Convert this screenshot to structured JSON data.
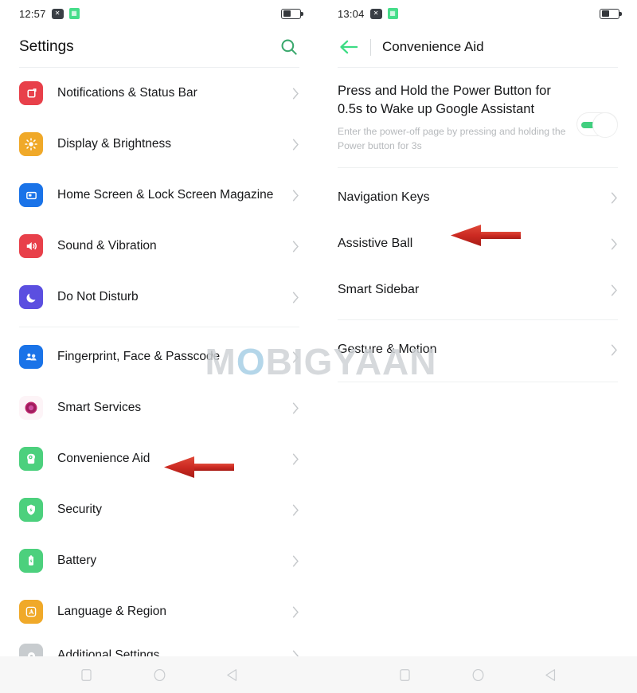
{
  "colors": {
    "accent_green": "#3ddc84",
    "toggle_on": "#41cf7f",
    "arrow_red": "#cc2a22",
    "text_primary": "#17181a",
    "text_muted": "#b6b9bc",
    "watermark": "#cfd3d6"
  },
  "left_screen": {
    "statusbar": {
      "time": "12:57",
      "icons": [
        "close-box-icon",
        "calculator-icon"
      ],
      "battery": {
        "name": "battery-icon",
        "level_pct": 45
      }
    },
    "header": {
      "title": "Settings",
      "search_icon": "search-icon"
    },
    "items": [
      {
        "label": "Notifications & Status Bar",
        "icon": "notifications-icon",
        "icon_bg": "#e8404a",
        "chevron": "chevron-right-icon"
      },
      {
        "label": "Display & Brightness",
        "icon": "brightness-icon",
        "icon_bg": "#f0a929",
        "chevron": "chevron-right-icon"
      },
      {
        "label": "Home Screen & Lock Screen Magazine",
        "icon": "home-screen-icon",
        "icon_bg": "#1a73e8",
        "chevron": "chevron-right-icon"
      },
      {
        "label": "Sound & Vibration",
        "icon": "sound-icon",
        "icon_bg": "#e8404a",
        "chevron": "chevron-right-icon"
      },
      {
        "label": "Do Not Disturb",
        "icon": "moon-icon",
        "icon_bg": "#5b4fe0",
        "chevron": "chevron-right-icon"
      },
      {
        "label": "Fingerprint, Face & Passcode",
        "icon": "fingerprint-face-icon",
        "icon_bg": "#1a73e8",
        "chevron": "chevron-right-icon"
      },
      {
        "label": "Smart Services",
        "icon": "smart-services-icon",
        "icon_bg": "#fdf4f7",
        "chevron": "chevron-right-icon"
      },
      {
        "label": "Convenience Aid",
        "icon": "convenience-aid-icon",
        "icon_bg": "#4cd07d",
        "chevron": "chevron-right-icon"
      },
      {
        "label": "Security",
        "icon": "security-shield-icon",
        "icon_bg": "#4cd07d",
        "chevron": "chevron-right-icon"
      },
      {
        "label": "Battery",
        "icon": "battery-settings-icon",
        "icon_bg": "#4cd07d",
        "chevron": "chevron-right-icon"
      },
      {
        "label": "Language & Region",
        "icon": "language-icon",
        "icon_bg": "#f0a929",
        "chevron": "chevron-right-icon"
      },
      {
        "label": "Additional Settings",
        "icon": "additional-settings-icon",
        "icon_bg": "#c8cccf",
        "chevron": "chevron-right-icon"
      }
    ]
  },
  "right_screen": {
    "statusbar": {
      "time": "13:04",
      "icons": [
        "close-box-icon",
        "calculator-icon"
      ],
      "battery": {
        "name": "battery-icon",
        "level_pct": 45
      }
    },
    "header": {
      "back_icon": "back-arrow-icon",
      "title": "Convenience Aid"
    },
    "power_setting": {
      "title": "Press and Hold the Power Button for 0.5s to Wake up Google Assistant",
      "subtitle": "Enter the power-off page by pressing and holding the Power button for 3s",
      "toggle_state": "on"
    },
    "items": [
      {
        "label": "Navigation Keys",
        "chevron": "chevron-right-icon"
      },
      {
        "label": "Assistive Ball",
        "chevron": "chevron-right-icon"
      },
      {
        "label": "Smart Sidebar",
        "chevron": "chevron-right-icon"
      },
      {
        "label": "Gesture & Motion",
        "chevron": "chevron-right-icon"
      }
    ]
  },
  "annotations": [
    {
      "name": "arrow-convenience-aid",
      "points_to": "Convenience Aid"
    },
    {
      "name": "arrow-navigation-keys",
      "points_to": "Navigation Keys"
    }
  ],
  "watermark": {
    "prefix": "M",
    "circle": "O",
    "suffix": "BIGYAAN"
  },
  "navbar": {
    "buttons": [
      "recents-square-icon",
      "home-circle-icon",
      "back-triangle-icon"
    ]
  }
}
